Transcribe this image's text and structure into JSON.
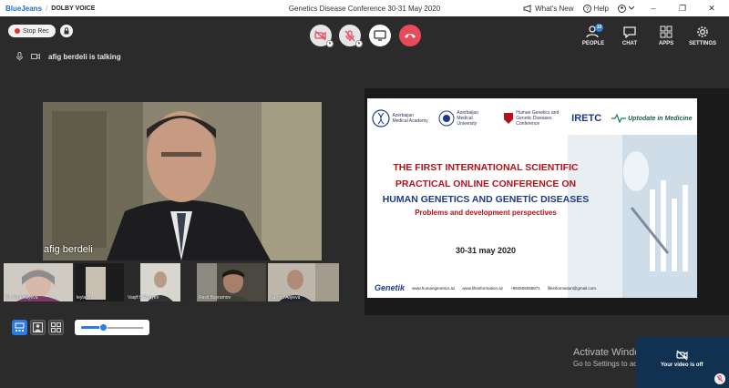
{
  "titlebar": {
    "brand_bluejeans": "BlueJeans",
    "brand_separator": "/",
    "brand_dolby": "DOLBY VOICE",
    "window_title": "Genetics Disease Conference 30-31 May 2020",
    "whats_new": "What's New",
    "help": "Help",
    "minimize": "–",
    "maximize": "❐",
    "close": "✕"
  },
  "toolbar": {
    "stop_rec_label": "Stop Rec",
    "people_label": "PEOPLE",
    "people_count": "10",
    "chat_label": "CHAT",
    "apps_label": "APPS",
    "settings_label": "SETTINGS"
  },
  "status": {
    "talking_text": "afig berdeli is talking"
  },
  "main_speaker": {
    "name": "afig berdeli"
  },
  "participants": [
    {
      "name": "Dr. Gedi Aliyeva"
    },
    {
      "name": "leyla H"
    },
    {
      "name": "Vaqif H Rzayev"
    },
    {
      "name": "Ravil Bayramov"
    },
    {
      "name": "Narmin Aliyeva"
    }
  ],
  "slide": {
    "logo_1": "Azerbaijan Medical Academy",
    "logo_2": "Azerbaijan Medical University",
    "logo_3": "Human Genetics and Genetic Diseases Conference",
    "logo_4": "IRETC",
    "logo_5": "Uptodate in Medicine",
    "title_line1": "THE FIRST INTERNATIONAL SCIENTIFIC",
    "title_line2": "PRACTICAL ONLINE CONFERENCE ON",
    "title_line3": "HUMAN GENETICS AND GENETİC DISEASES",
    "subtitle": "Problems and development perspectives",
    "date": "30-31 may 2020",
    "footer_logo": "Genetik",
    "footer_web1": "www.humangenetics.az",
    "footer_web2": "www.lifeinformation.az",
    "footer_phone": "+994505058871",
    "footer_email": "lifeinformation@gmail.com"
  },
  "activation": {
    "line1": "Activate Windows",
    "line2": "Go to Settings to activate Windows."
  },
  "selfview": {
    "text": "Your video is off"
  },
  "colors": {
    "accent": "#2d7ae0",
    "end_call": "#e94a5a",
    "background": "#2b2b2b"
  }
}
